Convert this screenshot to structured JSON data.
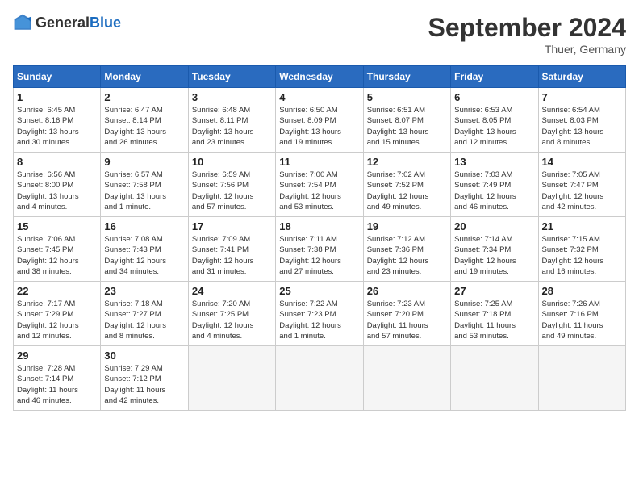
{
  "header": {
    "logo_general": "General",
    "logo_blue": "Blue",
    "title": "September 2024",
    "location": "Thuer, Germany"
  },
  "days_of_week": [
    "Sunday",
    "Monday",
    "Tuesday",
    "Wednesday",
    "Thursday",
    "Friday",
    "Saturday"
  ],
  "weeks": [
    [
      {
        "day": "1",
        "info": "Sunrise: 6:45 AM\nSunset: 8:16 PM\nDaylight: 13 hours\nand 30 minutes."
      },
      {
        "day": "2",
        "info": "Sunrise: 6:47 AM\nSunset: 8:14 PM\nDaylight: 13 hours\nand 26 minutes."
      },
      {
        "day": "3",
        "info": "Sunrise: 6:48 AM\nSunset: 8:11 PM\nDaylight: 13 hours\nand 23 minutes."
      },
      {
        "day": "4",
        "info": "Sunrise: 6:50 AM\nSunset: 8:09 PM\nDaylight: 13 hours\nand 19 minutes."
      },
      {
        "day": "5",
        "info": "Sunrise: 6:51 AM\nSunset: 8:07 PM\nDaylight: 13 hours\nand 15 minutes."
      },
      {
        "day": "6",
        "info": "Sunrise: 6:53 AM\nSunset: 8:05 PM\nDaylight: 13 hours\nand 12 minutes."
      },
      {
        "day": "7",
        "info": "Sunrise: 6:54 AM\nSunset: 8:03 PM\nDaylight: 13 hours\nand 8 minutes."
      }
    ],
    [
      {
        "day": "8",
        "info": "Sunrise: 6:56 AM\nSunset: 8:00 PM\nDaylight: 13 hours\nand 4 minutes."
      },
      {
        "day": "9",
        "info": "Sunrise: 6:57 AM\nSunset: 7:58 PM\nDaylight: 13 hours\nand 1 minute."
      },
      {
        "day": "10",
        "info": "Sunrise: 6:59 AM\nSunset: 7:56 PM\nDaylight: 12 hours\nand 57 minutes."
      },
      {
        "day": "11",
        "info": "Sunrise: 7:00 AM\nSunset: 7:54 PM\nDaylight: 12 hours\nand 53 minutes."
      },
      {
        "day": "12",
        "info": "Sunrise: 7:02 AM\nSunset: 7:52 PM\nDaylight: 12 hours\nand 49 minutes."
      },
      {
        "day": "13",
        "info": "Sunrise: 7:03 AM\nSunset: 7:49 PM\nDaylight: 12 hours\nand 46 minutes."
      },
      {
        "day": "14",
        "info": "Sunrise: 7:05 AM\nSunset: 7:47 PM\nDaylight: 12 hours\nand 42 minutes."
      }
    ],
    [
      {
        "day": "15",
        "info": "Sunrise: 7:06 AM\nSunset: 7:45 PM\nDaylight: 12 hours\nand 38 minutes."
      },
      {
        "day": "16",
        "info": "Sunrise: 7:08 AM\nSunset: 7:43 PM\nDaylight: 12 hours\nand 34 minutes."
      },
      {
        "day": "17",
        "info": "Sunrise: 7:09 AM\nSunset: 7:41 PM\nDaylight: 12 hours\nand 31 minutes."
      },
      {
        "day": "18",
        "info": "Sunrise: 7:11 AM\nSunset: 7:38 PM\nDaylight: 12 hours\nand 27 minutes."
      },
      {
        "day": "19",
        "info": "Sunrise: 7:12 AM\nSunset: 7:36 PM\nDaylight: 12 hours\nand 23 minutes."
      },
      {
        "day": "20",
        "info": "Sunrise: 7:14 AM\nSunset: 7:34 PM\nDaylight: 12 hours\nand 19 minutes."
      },
      {
        "day": "21",
        "info": "Sunrise: 7:15 AM\nSunset: 7:32 PM\nDaylight: 12 hours\nand 16 minutes."
      }
    ],
    [
      {
        "day": "22",
        "info": "Sunrise: 7:17 AM\nSunset: 7:29 PM\nDaylight: 12 hours\nand 12 minutes."
      },
      {
        "day": "23",
        "info": "Sunrise: 7:18 AM\nSunset: 7:27 PM\nDaylight: 12 hours\nand 8 minutes."
      },
      {
        "day": "24",
        "info": "Sunrise: 7:20 AM\nSunset: 7:25 PM\nDaylight: 12 hours\nand 4 minutes."
      },
      {
        "day": "25",
        "info": "Sunrise: 7:22 AM\nSunset: 7:23 PM\nDaylight: 12 hours\nand 1 minute."
      },
      {
        "day": "26",
        "info": "Sunrise: 7:23 AM\nSunset: 7:20 PM\nDaylight: 11 hours\nand 57 minutes."
      },
      {
        "day": "27",
        "info": "Sunrise: 7:25 AM\nSunset: 7:18 PM\nDaylight: 11 hours\nand 53 minutes."
      },
      {
        "day": "28",
        "info": "Sunrise: 7:26 AM\nSunset: 7:16 PM\nDaylight: 11 hours\nand 49 minutes."
      }
    ],
    [
      {
        "day": "29",
        "info": "Sunrise: 7:28 AM\nSunset: 7:14 PM\nDaylight: 11 hours\nand 46 minutes."
      },
      {
        "day": "30",
        "info": "Sunrise: 7:29 AM\nSunset: 7:12 PM\nDaylight: 11 hours\nand 42 minutes."
      },
      {
        "day": "",
        "info": ""
      },
      {
        "day": "",
        "info": ""
      },
      {
        "day": "",
        "info": ""
      },
      {
        "day": "",
        "info": ""
      },
      {
        "day": "",
        "info": ""
      }
    ]
  ]
}
